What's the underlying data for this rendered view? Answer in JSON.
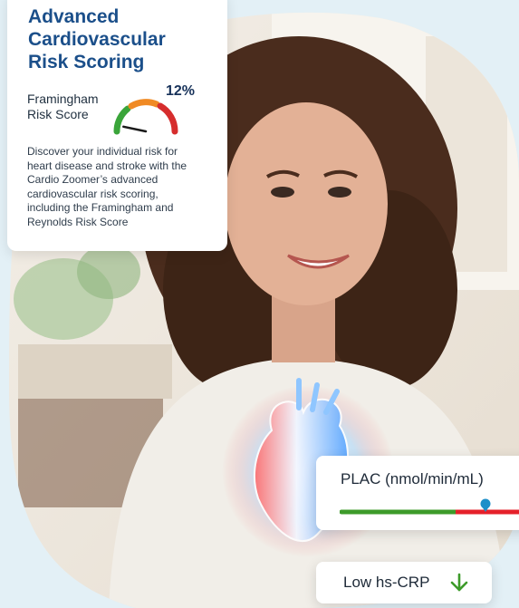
{
  "card": {
    "title_lines": [
      "Advanced",
      "Cardiovascular",
      "Risk Scoring"
    ],
    "gauge_label_lines": [
      "Framingham",
      "Risk Score"
    ],
    "gauge_value": "12%",
    "gauge_fraction": 0.12,
    "description_lines": [
      "Discover your individual risk for",
      "heart disease and stroke with the",
      "Cardio Zoomer’s advanced",
      "cardiovascular risk scoring,",
      "including the Framingham and",
      "Reynolds Risk Score"
    ]
  },
  "plac": {
    "title": "PLAC (nmol/min/mL)",
    "marker_fraction": 0.75
  },
  "crp": {
    "label": "Low hs-CRP",
    "icon": "arrow-down-icon"
  },
  "colors": {
    "title": "#1b4f8a",
    "gauge_green": "#3aa53a",
    "gauge_orange": "#f08a24",
    "gauge_red": "#d62d2d",
    "bar_green": "#3d9b2a",
    "bar_red": "#e5202a",
    "marker": "#1e8fc9",
    "arrow": "#3d9b2a"
  }
}
